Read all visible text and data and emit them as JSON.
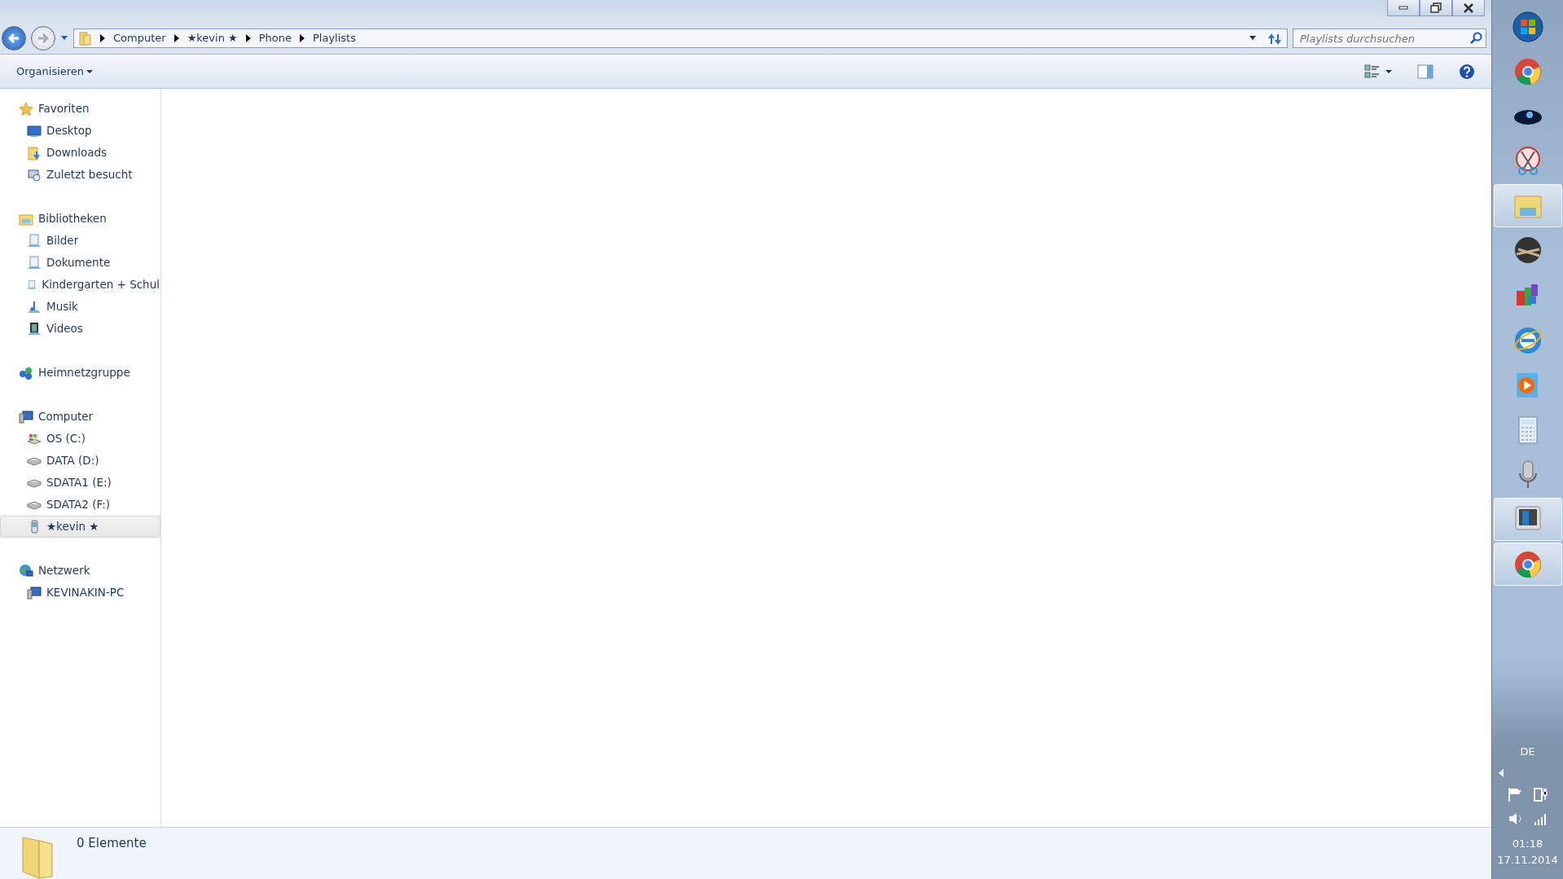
{
  "window": {
    "controls": [
      {
        "kind": "minimize"
      },
      {
        "kind": "restore"
      },
      {
        "kind": "close"
      }
    ]
  },
  "address_bar": {
    "back_enabled": true,
    "forward_enabled": false,
    "breadcrumbs": [
      "Computer",
      "★kevin ★",
      "Phone",
      "Playlists"
    ]
  },
  "search": {
    "placeholder": "Playlists durchsuchen"
  },
  "toolbar": {
    "organize": "Organisieren"
  },
  "sidebar": {
    "groups": [
      {
        "label": "Favoriten",
        "kind": "star",
        "children": [
          {
            "label": "Desktop",
            "kind": "desktop",
            "selected": false
          },
          {
            "label": "Downloads",
            "kind": "downloads",
            "selected": false
          },
          {
            "label": "Zuletzt besucht",
            "kind": "recent",
            "selected": false
          }
        ]
      },
      {
        "label": "Bibliotheken",
        "kind": "library",
        "children": [
          {
            "label": "Bilder",
            "kind": "doc",
            "selected": false
          },
          {
            "label": "Dokumente",
            "kind": "doc",
            "selected": false
          },
          {
            "label": "Kindergarten + Schul",
            "kind": "doc",
            "selected": false
          },
          {
            "label": "Musik",
            "kind": "music",
            "selected": false
          },
          {
            "label": "Videos",
            "kind": "video",
            "selected": false
          }
        ]
      },
      {
        "label": "Heimnetzgruppe",
        "kind": "homegroup"
      },
      {
        "label": "Computer",
        "kind": "computer",
        "children": [
          {
            "label": "OS (C:)",
            "kind": "osdrive",
            "selected": false
          },
          {
            "label": "DATA (D:)",
            "kind": "drive",
            "selected": false
          },
          {
            "label": "SDATA1 (E:)",
            "kind": "drive",
            "selected": false
          },
          {
            "label": "SDATA2 (F:)",
            "kind": "drive",
            "selected": false
          },
          {
            "label": "★kevin ★",
            "kind": "phone",
            "selected": true
          }
        ]
      },
      {
        "label": "Netzwerk",
        "kind": "network",
        "children": [
          {
            "label": "KEVINAKIN-PC",
            "kind": "computer",
            "selected": false
          }
        ]
      }
    ]
  },
  "status_bar": {
    "text": "0 Elemente"
  },
  "taskbar": {
    "items": [
      {
        "kind": "start",
        "active": false
      },
      {
        "kind": "chrome",
        "active": false
      },
      {
        "kind": "dark",
        "active": false
      },
      {
        "kind": "snip",
        "active": false
      },
      {
        "kind": "explorer",
        "active": true
      },
      {
        "kind": "game",
        "active": false
      },
      {
        "kind": "blocks",
        "active": false
      },
      {
        "kind": "ie",
        "active": false
      },
      {
        "kind": "media",
        "active": false
      },
      {
        "kind": "calc",
        "active": false
      },
      {
        "kind": "mic",
        "active": false
      },
      {
        "kind": "monitor",
        "active": true
      },
      {
        "kind": "chrome",
        "active": true
      }
    ],
    "language": "DE",
    "time": "01:18",
    "date": "17.11.2014"
  }
}
